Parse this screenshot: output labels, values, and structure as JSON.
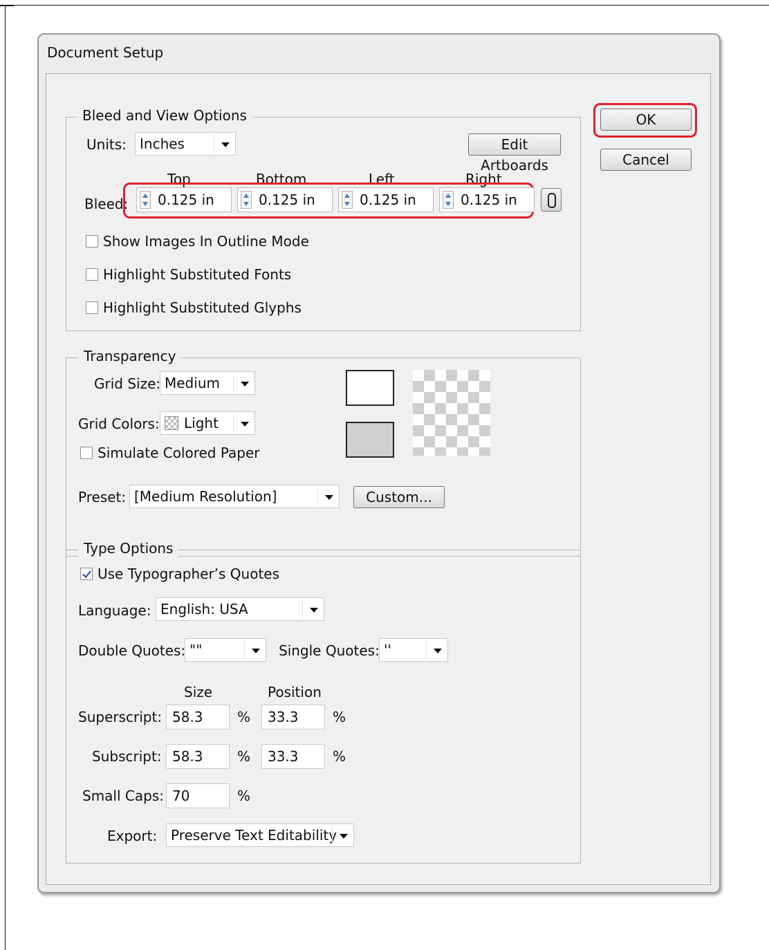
{
  "dialog": {
    "title": "Document Setup"
  },
  "buttons": {
    "ok": "OK",
    "cancel": "Cancel"
  },
  "bleed_view": {
    "legend": "Bleed and View Options",
    "units_label": "Units:",
    "units_value": "Inches",
    "edit_artboards": "Edit Artboards",
    "bleed_label": "Bleed:",
    "col_top": "Top",
    "col_bottom": "Bottom",
    "col_left": "Left",
    "col_right": "Right",
    "bleed_top": "0.125 in",
    "bleed_bottom": "0.125 in",
    "bleed_left": "0.125 in",
    "bleed_right": "0.125 in",
    "show_images": "Show Images In Outline Mode",
    "highlight_fonts": "Highlight Substituted Fonts",
    "highlight_glyphs": "Highlight Substituted Glyphs",
    "show_images_checked": false,
    "highlight_fonts_checked": false,
    "highlight_glyphs_checked": false
  },
  "transparency": {
    "legend": "Transparency",
    "grid_size_label": "Grid Size:",
    "grid_size_value": "Medium",
    "grid_colors_label": "Grid Colors:",
    "grid_colors_value": "Light",
    "simulate_paper": "Simulate Colored Paper",
    "simulate_paper_checked": false,
    "preset_label": "Preset:",
    "preset_value": "[Medium Resolution]",
    "custom_button": "Custom..."
  },
  "type_options": {
    "legend": "Type Options",
    "typographers_quotes": "Use Typographer’s Quotes",
    "typographers_quotes_checked": true,
    "language_label": "Language:",
    "language_value": "English: USA",
    "double_quotes_label": "Double Quotes:",
    "double_quotes_value": "\"\"",
    "single_quotes_label": "Single Quotes:",
    "single_quotes_value": "''",
    "size_header": "Size",
    "position_header": "Position",
    "superscript_label": "Superscript:",
    "superscript_size": "58.3",
    "superscript_position": "33.3",
    "subscript_label": "Subscript:",
    "subscript_size": "58.3",
    "subscript_position": "33.3",
    "small_caps_label": "Small Caps:",
    "small_caps_value": "70",
    "percent": "%",
    "export_label": "Export:",
    "export_value": "Preserve Text Editability"
  },
  "colors": {
    "highlight": "#e0202c",
    "check": "#1b4fa0"
  }
}
